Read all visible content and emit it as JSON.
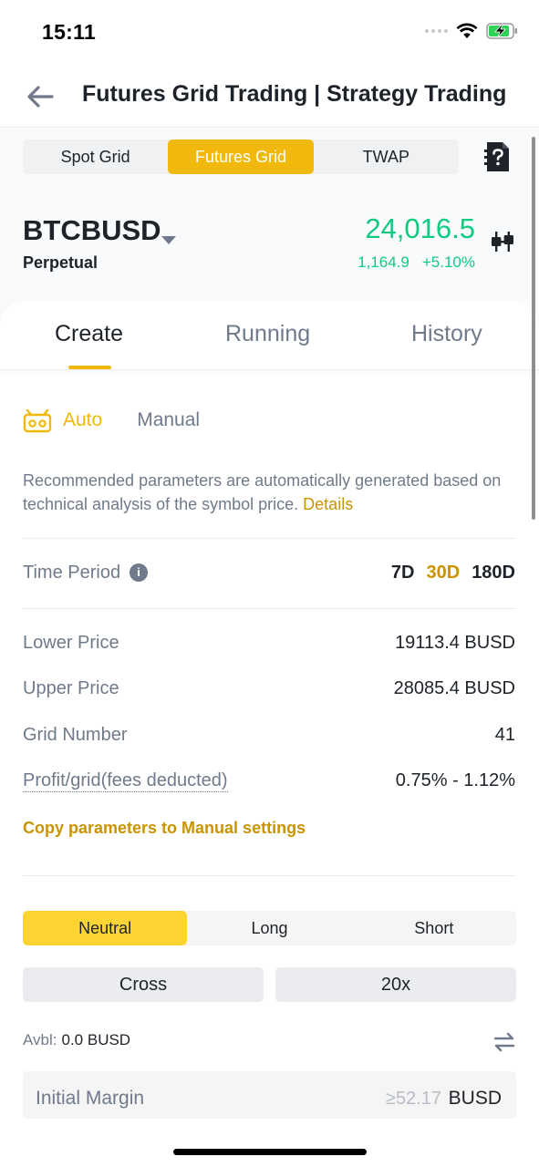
{
  "status_bar": {
    "time": "15:11"
  },
  "header": {
    "title": "Futures Grid Trading | Strategy Trading"
  },
  "strategy_tabs": [
    "Spot Grid",
    "Futures Grid",
    "TWAP"
  ],
  "symbol": {
    "name": "BTCBUSD",
    "type": "Perpetual",
    "price": "24,016.5",
    "change_abs": "1,164.9",
    "change_pct": "+5.10%"
  },
  "main_tabs": [
    "Create",
    "Running",
    "History"
  ],
  "mode": {
    "auto": "Auto",
    "manual": "Manual"
  },
  "description": {
    "text": "Recommended parameters are automatically generated based on technical analysis of the symbol price.",
    "link": "Details"
  },
  "time_period": {
    "label": "Time Period",
    "options": [
      "7D",
      "30D",
      "180D"
    ],
    "selected": "30D"
  },
  "params": {
    "lower_price": {
      "label": "Lower Price",
      "value": "19113.4 BUSD"
    },
    "upper_price": {
      "label": "Upper Price",
      "value": "28085.4 BUSD"
    },
    "grid_number": {
      "label": "Grid Number",
      "value": "41"
    },
    "profit_grid": {
      "label": "Profit/grid(fees deducted)",
      "value": "0.75% - 1.12%"
    }
  },
  "copy_link": "Copy parameters to Manual settings",
  "direction": {
    "options": [
      "Neutral",
      "Long",
      "Short"
    ],
    "selected": "Neutral"
  },
  "margin": {
    "mode": "Cross",
    "leverage": "20x"
  },
  "available": {
    "label": "Avbl:",
    "value": "0.0 BUSD"
  },
  "initial_margin": {
    "label": "Initial Margin",
    "placeholder": "≥52.17",
    "unit": "BUSD"
  },
  "colors": {
    "accent": "#f0b90b",
    "accent_text": "#c99400",
    "positive": "#0ecb81",
    "neutral_active": "#fcd535"
  }
}
